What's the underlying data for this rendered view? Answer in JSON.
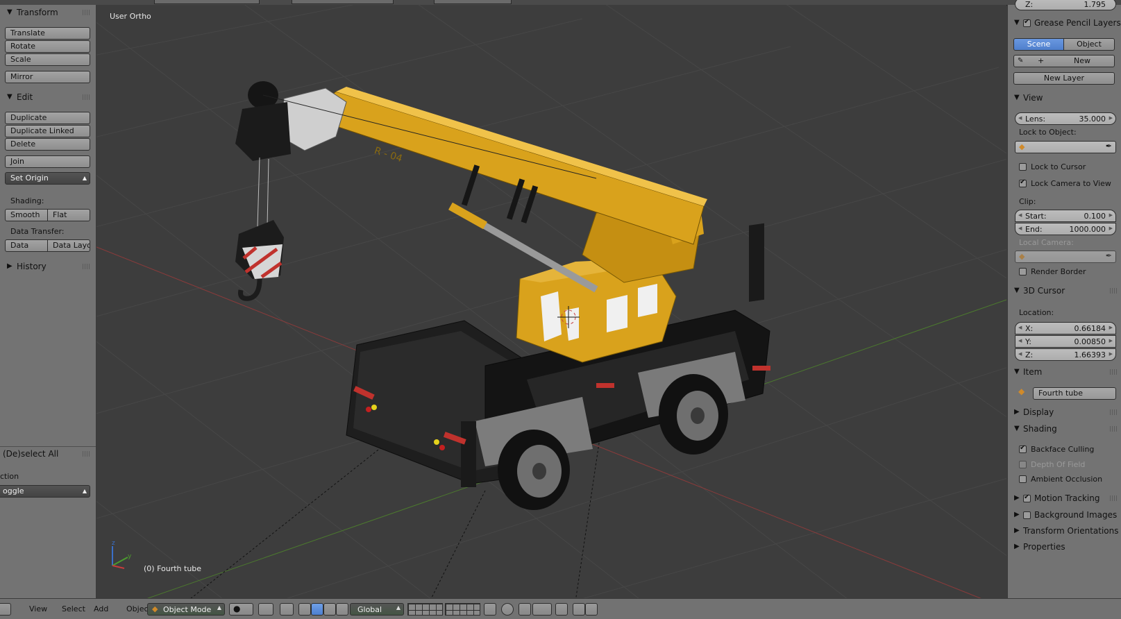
{
  "viewport": {
    "view_name": "User Ortho",
    "active_object": "(0) Fourth tube",
    "crane_marking": "R - 04"
  },
  "left_panel": {
    "transform": {
      "title": "Transform",
      "buttons": [
        "Translate",
        "Rotate",
        "Scale"
      ],
      "mirror": "Mirror"
    },
    "edit": {
      "title": "Edit",
      "duplicate": "Duplicate",
      "duplicate_linked": "Duplicate Linked",
      "delete": "Delete",
      "join": "Join",
      "set_origin": "Set Origin",
      "shading_label": "Shading:",
      "smooth": "Smooth",
      "flat": "Flat",
      "data_transfer_label": "Data Transfer:",
      "data": "Data",
      "data_layout": "Data Layo"
    },
    "history": {
      "title": "History"
    },
    "operator": {
      "title": "(De)select All",
      "action_label": "ction",
      "action_value": "oggle"
    }
  },
  "right_panel": {
    "top_field": "Z:",
    "top_field_value": "1.795",
    "grease_pencil": {
      "title": "Grease Pencil Layers",
      "enabled": true,
      "tabs": [
        "Scene",
        "Object"
      ],
      "new": "New",
      "new_layer": "New Layer"
    },
    "view": {
      "title": "View",
      "lens_label": "Lens:",
      "lens_value": "35.000",
      "lock_to_object": "Lock to Object:",
      "lock_to_cursor": "Lock to Cursor",
      "lock_to_cursor_checked": false,
      "lock_camera": "Lock Camera to View",
      "lock_camera_checked": true,
      "clip_label": "Clip:",
      "clip_start_label": "Start:",
      "clip_start": "0.100",
      "clip_end_label": "End:",
      "clip_end": "1000.000",
      "local_camera": "Local Camera:",
      "render_border": "Render Border",
      "render_border_checked": false
    },
    "cursor": {
      "title": "3D Cursor",
      "location_label": "Location:",
      "x_label": "X:",
      "x": "0.66184",
      "y_label": "Y:",
      "y": "0.00850",
      "z_label": "Z:",
      "z": "1.66393"
    },
    "item": {
      "title": "Item",
      "name": "Fourth tube"
    },
    "display": {
      "title": "Display"
    },
    "shading": {
      "title": "Shading",
      "backface": "Backface Culling",
      "backface_checked": true,
      "dof": "Depth Of Field",
      "ao": "Ambient Occlusion"
    },
    "motion_tracking": {
      "title": "Motion Tracking",
      "checked": true
    },
    "background_images": {
      "title": "Background Images",
      "checked": false
    },
    "transform_orientations": {
      "title": "Transform Orientations"
    },
    "properties": {
      "title": "Properties"
    }
  },
  "bottom_bar": {
    "menus": [
      "View",
      "Select",
      "Add",
      "Object"
    ],
    "mode": "Object Mode",
    "orientation": "Global"
  },
  "colors": {
    "panel": "#737373",
    "viewport_bg": "#3d3d3d",
    "accent_blue": "#5680c2",
    "crane_yellow": "#d9a21c"
  }
}
